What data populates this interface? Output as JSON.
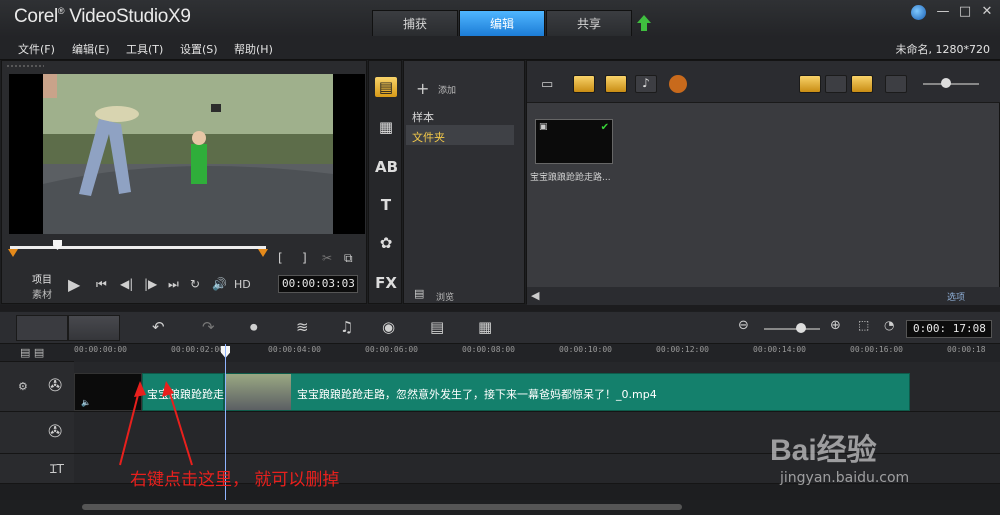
{
  "app": {
    "title_prefix": "Corel",
    "title_main": "VideoStudioX9"
  },
  "tabs": [
    {
      "label": "捕获"
    },
    {
      "label": "编辑"
    },
    {
      "label": "共享"
    }
  ],
  "menus": [
    "文件(F)",
    "编辑(E)",
    "工具(T)",
    "设置(S)",
    "帮助(H)"
  ],
  "project_info": "未命名, 1280*720",
  "player": {
    "mode_project": "项目",
    "mode_clip": "素材",
    "timecode": "00:00:03:03",
    "hd_label": "HD",
    "bracket_in": "[",
    "bracket_out": "]"
  },
  "library": {
    "add_label": "添加",
    "tree": [
      "样本",
      "文件夹"
    ],
    "browse_label": "浏览",
    "thumb_label": "宝宝踉踉跄跄走路...",
    "options_label": "选项"
  },
  "timeline": {
    "timecode": "0:00: 17:08",
    "ruler": [
      "00:00:00:00",
      "00:00:02:00",
      "00:00:04:00",
      "00:00:06:00",
      "00:00:08:00",
      "00:00:10:00",
      "00:00:12:00",
      "00:00:14:00",
      "00:00:16:00",
      "00:00:18"
    ],
    "clip1_label": "宝宝踉踉跄跄走",
    "clip2_label": "宝宝踉踉跄跄走路，忽然意外发生了，接下来一幕爸妈都惊呆了！_0.mp4"
  },
  "annotation": "右键点击这里，  就可以删掉",
  "watermark": {
    "brand": "Bai经验",
    "url": "jingyan.baidu.com"
  },
  "colors": {
    "accent_tab": "#1c7cd6",
    "clip": "#14806c",
    "annotation": "#e8201d"
  },
  "icons": [
    "globe-icon",
    "minimize-icon",
    "maximize-icon",
    "close-icon",
    "play-icon",
    "undo-icon",
    "redo-icon",
    "zoom-in-icon",
    "zoom-out-icon"
  ]
}
